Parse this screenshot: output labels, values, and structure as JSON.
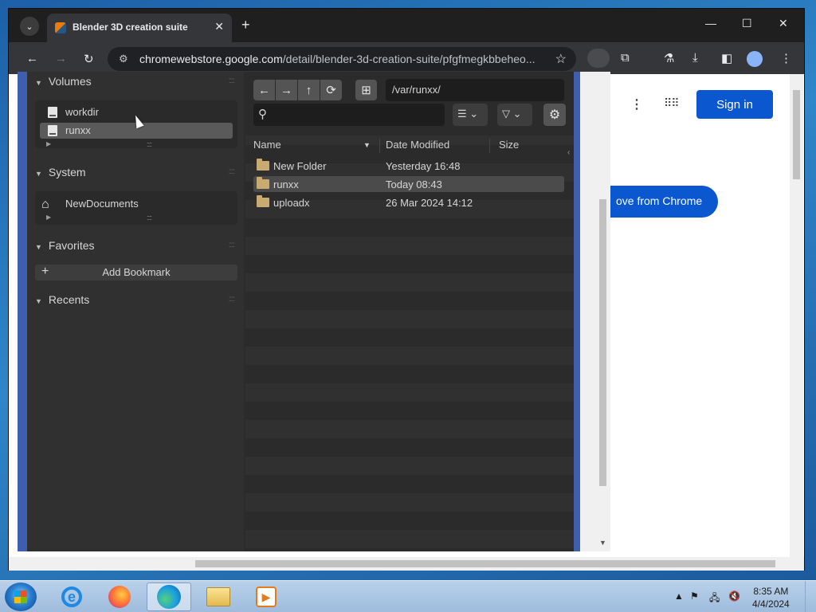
{
  "browser": {
    "tab_title": "Blender 3D creation suite",
    "tab_close": "✕",
    "new_tab": "+",
    "url_domain": "chromewebstore.google.com",
    "url_rest": "/detail/blender-3d-creation-suite/pfgfmegkbbeheo...",
    "window_controls": {
      "minimize": "—",
      "maximize": "☐",
      "close": "✕"
    }
  },
  "webpage": {
    "sign_in": "Sign in",
    "remove_button": "ove from Chrome"
  },
  "blender": {
    "volumes": {
      "header": "Volumes",
      "items": [
        {
          "label": "workdir"
        },
        {
          "label": "runxx",
          "selected": true
        }
      ]
    },
    "system": {
      "header": "System",
      "items": [
        {
          "label": "NewDocuments"
        }
      ]
    },
    "favorites": {
      "header": "Favorites",
      "add_bookmark": "Add Bookmark"
    },
    "recents": {
      "header": "Recents"
    },
    "path": "/var/runxx/",
    "columns": {
      "name": "Name",
      "date": "Date Modified",
      "size": "Size"
    },
    "files": [
      {
        "name": "New Folder",
        "date": "Yesterday 16:48"
      },
      {
        "name": "runxx",
        "date": "Today 08:43",
        "selected": true
      },
      {
        "name": "uploadx",
        "date": "26 Mar 2024 14:12"
      }
    ]
  },
  "taskbar": {
    "time": "8:35 AM",
    "date": "4/4/2024"
  },
  "colors": {
    "blender_accent": "#3e5fae",
    "chrome_blue": "#0b57d0",
    "folder": "#c9aa71"
  }
}
